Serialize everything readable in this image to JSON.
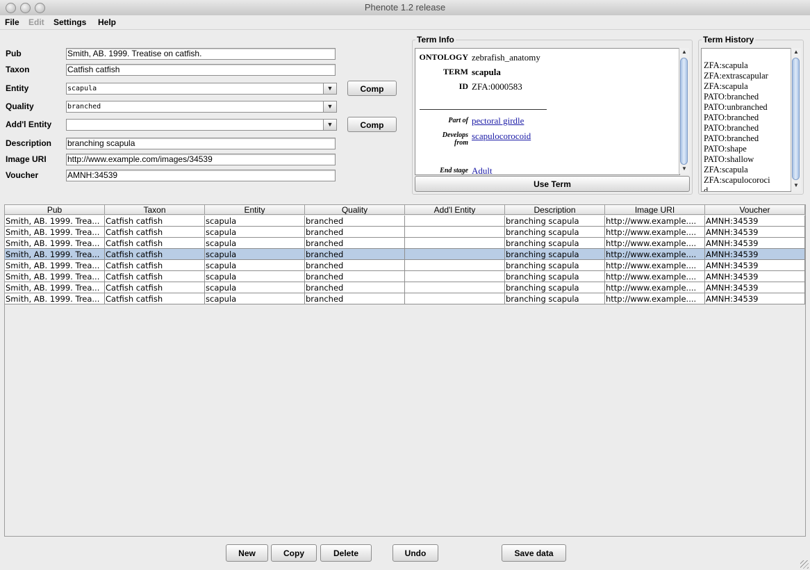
{
  "window": {
    "title": "Phenote 1.2 release"
  },
  "menu": [
    {
      "label": "File",
      "enabled": true
    },
    {
      "label": "Edit",
      "enabled": false
    },
    {
      "label": "Settings",
      "enabled": true
    },
    {
      "label": "Help",
      "enabled": true
    }
  ],
  "form": {
    "pub_label": "Pub",
    "pub_value": "Smith, AB. 1999. Treatise on catfish.",
    "taxon_label": "Taxon",
    "taxon_value": "Catfish catfish",
    "entity_label": "Entity",
    "entity_value": "scapula",
    "quality_label": "Quality",
    "quality_value": "branched",
    "addl_entity_label": "Add'l Entity",
    "addl_entity_value": "",
    "description_label": "Description",
    "description_value": "branching scapula",
    "image_uri_label": "Image URI",
    "image_uri_value": "http://www.example.com/images/34539",
    "voucher_label": "Voucher",
    "voucher_value": "AMNH:34539",
    "comp_label": "Comp"
  },
  "term_info": {
    "title": "Term Info",
    "ontology_label": "ONTOLOGY",
    "ontology_value": "zebrafish_anatomy",
    "term_label": "TERM",
    "term_value": "scapula",
    "id_label": "ID",
    "id_value": "ZFA:0000583",
    "part_of_label": "Part of",
    "part_of_value": "pectoral girdle",
    "develops_label_1": "Develops",
    "develops_label_2": "from",
    "develops_value": "scapulocorocoid",
    "end_stage_label": "End stage",
    "end_stage_value": "Adult",
    "use_term_label": "Use Term"
  },
  "term_history": {
    "title": "Term History",
    "items": [
      "ZFA:scapula",
      "ZFA:extrascapular",
      "ZFA:scapula",
      "PATO:branched",
      "PATO:unbranched",
      "PATO:branched",
      "PATO:branched",
      "PATO:branched",
      "PATO:shape",
      "PATO:shallow",
      "ZFA:scapula",
      "ZFA:scapulocoroci",
      "d"
    ]
  },
  "table": {
    "columns": [
      "Pub",
      "Taxon",
      "Entity",
      "Quality",
      "Add'l Entity",
      "Description",
      "Image URI",
      "Voucher"
    ],
    "selected_row": 3,
    "rows": [
      [
        "Smith, AB. 1999. Trea...",
        "Catfish catfish",
        "scapula",
        "branched",
        "",
        "branching scapula",
        "http://www.example....",
        "AMNH:34539"
      ],
      [
        "Smith, AB. 1999. Trea...",
        "Catfish catfish",
        "scapula",
        "branched",
        "",
        "branching scapula",
        "http://www.example....",
        "AMNH:34539"
      ],
      [
        "Smith, AB. 1999. Trea...",
        "Catfish catfish",
        "scapula",
        "branched",
        "",
        "branching scapula",
        "http://www.example....",
        "AMNH:34539"
      ],
      [
        "Smith, AB. 1999. Trea...",
        "Catfish catfish",
        "scapula",
        "branched",
        "",
        "branching scapula",
        "http://www.example....",
        "AMNH:34539"
      ],
      [
        "Smith, AB. 1999. Trea...",
        "Catfish catfish",
        "scapula",
        "branched",
        "",
        "branching scapula",
        "http://www.example....",
        "AMNH:34539"
      ],
      [
        "Smith, AB. 1999. Trea...",
        "Catfish catfish",
        "scapula",
        "branched",
        "",
        "branching scapula",
        "http://www.example....",
        "AMNH:34539"
      ],
      [
        "Smith, AB. 1999. Trea...",
        "Catfish catfish",
        "scapula",
        "branched",
        "",
        "branching scapula",
        "http://www.example....",
        "AMNH:34539"
      ],
      [
        "Smith, AB. 1999. Trea...",
        "Catfish catfish",
        "scapula",
        "branched",
        "",
        "branching scapula",
        "http://www.example....",
        "AMNH:34539"
      ]
    ]
  },
  "buttons": {
    "new": "New",
    "copy": "Copy",
    "delete": "Delete",
    "undo": "Undo",
    "save": "Save data"
  },
  "icons": {
    "combo_arrow": "chevron-down-icon",
    "scroll_up": "scroll-up-icon",
    "scroll_down": "scroll-down-icon",
    "resize_grip": "resize-grip-icon"
  },
  "colors": {
    "selection": "#b9cde5",
    "link": "#1a1aa6",
    "window_bg": "#ececec"
  }
}
